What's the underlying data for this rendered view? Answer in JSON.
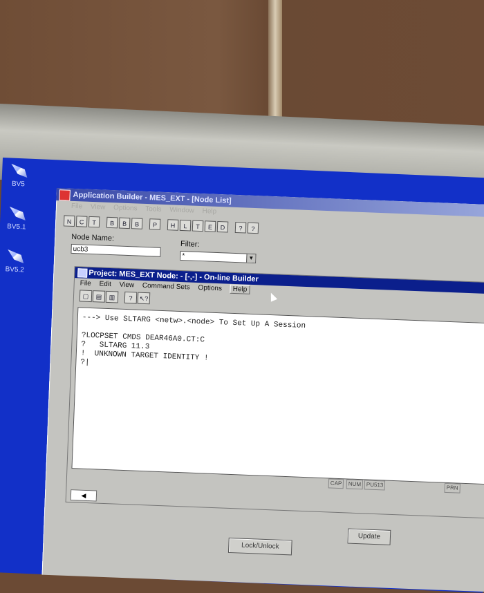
{
  "desktop": {
    "icons": [
      {
        "label": "BV5"
      },
      {
        "label": "BV5.1"
      },
      {
        "label": "BV5.2"
      }
    ]
  },
  "app": {
    "title": "Application Builder - MES_EXT - [Node List]",
    "menu": [
      "File",
      "View",
      "Options",
      "Tools",
      "Window",
      "Help"
    ],
    "toolbar_icons": [
      "N",
      "C",
      "T",
      "B",
      "B",
      "B",
      "P",
      "H",
      "L",
      "T",
      "E",
      "D",
      "?",
      "?"
    ],
    "node_name_label": "Node Name:",
    "node_name_value": "ucb3",
    "filter_label": "Filter:",
    "filter_value": "*"
  },
  "builder": {
    "title": "Project: MES_EXT  Node: - [-,-] - On-line Builder",
    "menu": [
      "File",
      "Edit",
      "View",
      "Command Sets",
      "Options",
      "Help"
    ],
    "toolbar_icons": [
      "new-icon",
      "open-icon",
      "save-icon",
      "help-icon",
      "context-help-icon"
    ],
    "console_lines": [
      "---> Use SLTARG <netw>.<node> To Set Up A Session",
      "",
      "?LOCPSET CMDS DEAR46A0.CT:C",
      "?   SLTARG 11.3",
      "!  UNKNOWN TARGET IDENTITY !",
      "?|"
    ],
    "status": {
      "cap": "CAP",
      "num": "NUM",
      "port": "PU513",
      "prn": "PRN"
    }
  },
  "buttons": {
    "update": "Update",
    "lock_unlock": "Lock/Unlock"
  }
}
